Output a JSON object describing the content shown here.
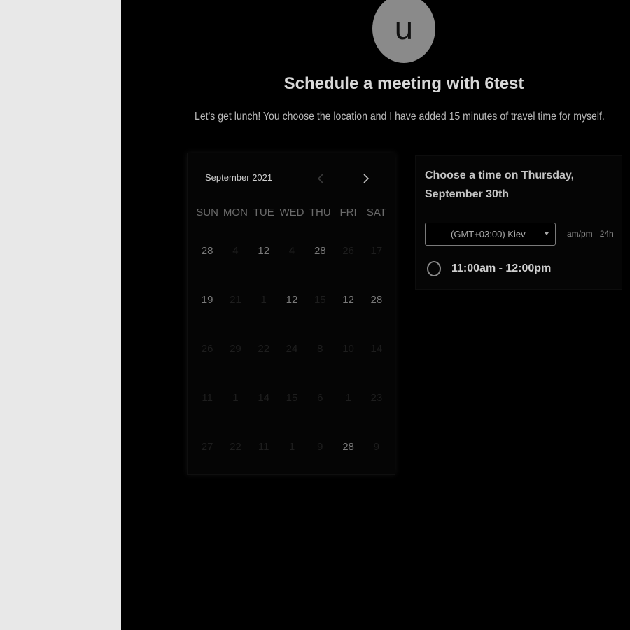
{
  "profile": {
    "avatar_letter": "u"
  },
  "header": {
    "title": "Schedule a meeting with 6test",
    "description": "Let's get lunch! You choose the location and I have added 15 minutes of travel time for myself."
  },
  "calendar": {
    "month_label": "September 2021",
    "weekdays": [
      "SUN",
      "MON",
      "TUE",
      "WED",
      "THU",
      "FRI",
      "SAT"
    ],
    "rows": [
      [
        "28",
        "4",
        "12",
        "4",
        "28",
        "26",
        "17"
      ],
      [
        "19",
        "21",
        "1",
        "12",
        "15",
        "12",
        "28"
      ],
      [
        "26",
        "29",
        "22",
        "24",
        "8",
        "10",
        "14"
      ],
      [
        "11",
        "1",
        "14",
        "15",
        "6",
        "1",
        "23"
      ],
      [
        "27",
        "22",
        "11",
        "1",
        "9",
        "28",
        "9"
      ]
    ]
  },
  "scheduler": {
    "heading": "Choose a time on Thursday, September 30th",
    "timezone": "(GMT+03:00) Kiev",
    "format_12h": "am/pm",
    "format_24h": "24h",
    "slots": [
      "11:00am - 12:00pm"
    ]
  },
  "colors": {
    "left_panel": "#e8e8e8",
    "background": "#000000",
    "avatar": "#8a8a8a"
  }
}
